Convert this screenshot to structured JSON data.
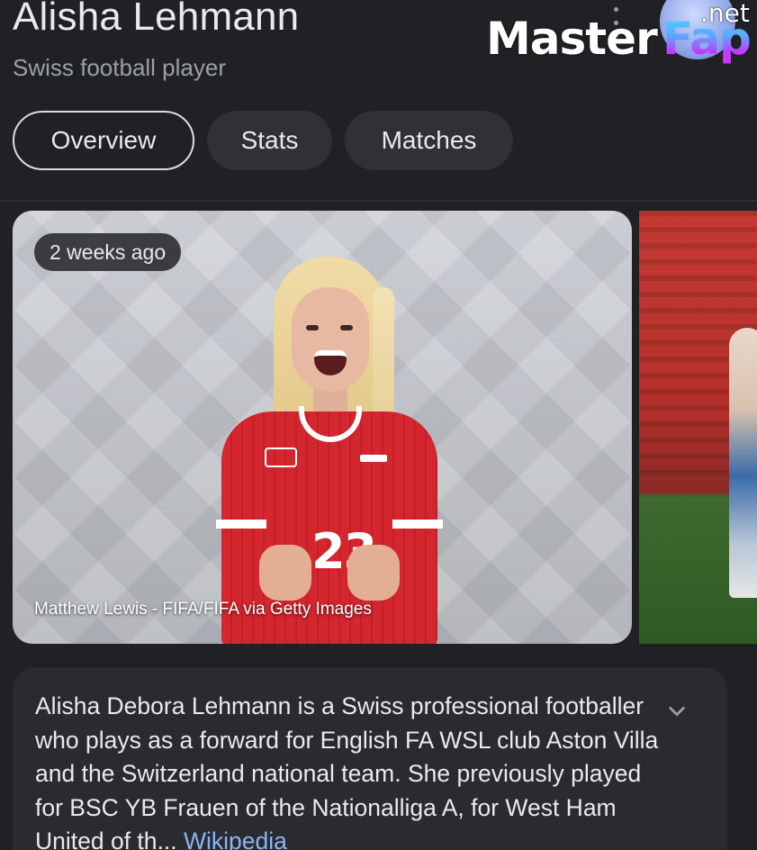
{
  "header": {
    "title": "Alisha Lehmann",
    "subtitle": "Swiss football player"
  },
  "watermark": {
    "part1": "Master",
    "part2": "Fap",
    "suffix": ".net"
  },
  "tabs": [
    {
      "label": "Overview",
      "active": true
    },
    {
      "label": "Stats",
      "active": false
    },
    {
      "label": "Matches",
      "active": false
    }
  ],
  "images": {
    "main": {
      "time_badge": "2 weeks ago",
      "credit": "Matthew Lewis - FIFA/FIFA via Getty Images",
      "jersey_number": "23"
    }
  },
  "description": {
    "text": "Alisha Debora Lehmann is a Swiss professional footballer who plays as a forward for English FA WSL club Aston Villa and the Switzerland national team. She previously played for BSC YB Frauen of the Nationalliga A, for West Ham United of th",
    "ellipsis": "...",
    "source_link": "Wikipedia"
  },
  "colors": {
    "background": "#1f2125",
    "chip": "#303134",
    "link": "#8ab4f8",
    "jersey": "#d3262e"
  },
  "icons": [
    "more-vert-icon",
    "chevron-down-icon"
  ]
}
